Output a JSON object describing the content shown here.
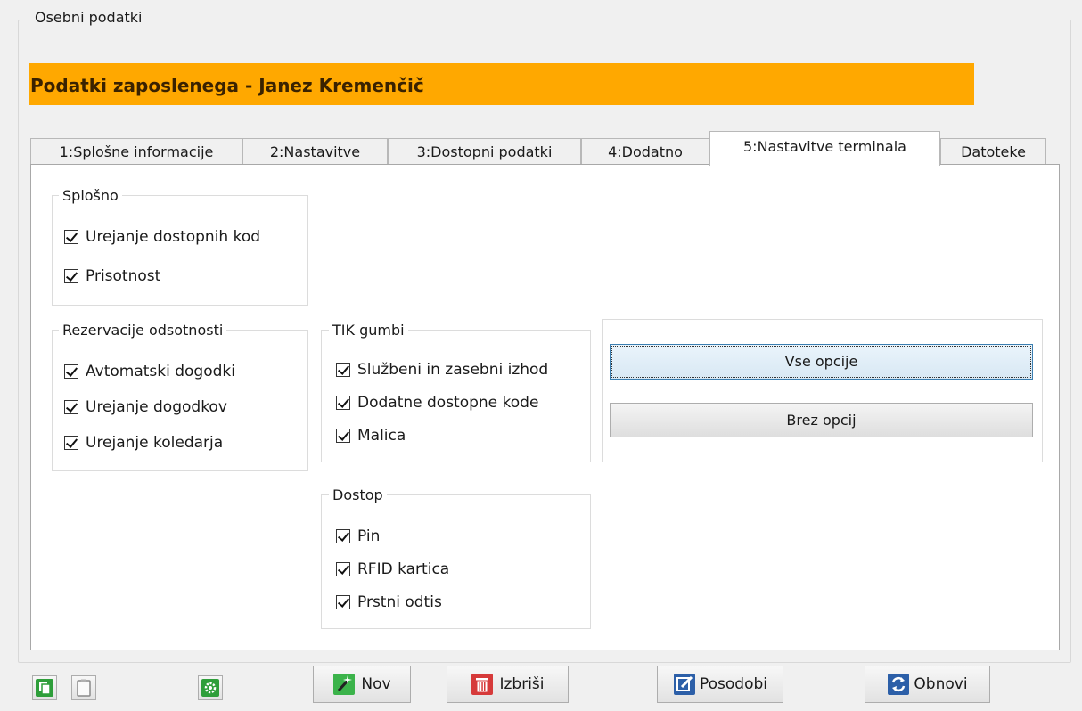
{
  "outer_group": {
    "label": "Osebni podatki"
  },
  "banner": {
    "title": "Podatki zaposlenega - Janez Kremenčič",
    "color": "#ffa800"
  },
  "tabs": [
    {
      "label": "1:Splošne informacije",
      "active": false
    },
    {
      "label": "2:Nastavitve",
      "active": false
    },
    {
      "label": "3:Dostopni podatki",
      "active": false
    },
    {
      "label": "4:Dodatno",
      "active": false
    },
    {
      "label": "5:Nastavitve terminala",
      "active": true
    },
    {
      "label": "Datoteke",
      "active": false
    }
  ],
  "groups": {
    "splosno": {
      "label": "Splošno",
      "items": [
        {
          "label": "Urejanje dostopnih kod",
          "checked": true
        },
        {
          "label": "Prisotnost",
          "checked": true
        }
      ]
    },
    "rezervacije": {
      "label": "Rezervacije odsotnosti",
      "items": [
        {
          "label": "Avtomatski dogodki",
          "checked": true
        },
        {
          "label": "Urejanje dogodkov",
          "checked": true
        },
        {
          "label": "Urejanje koledarja",
          "checked": true
        }
      ]
    },
    "tik": {
      "label": "TIK gumbi",
      "items": [
        {
          "label": "Službeni in zasebni izhod",
          "checked": true
        },
        {
          "label": "Dodatne dostopne kode",
          "checked": true
        },
        {
          "label": "Malica",
          "checked": true
        }
      ]
    },
    "dostop": {
      "label": "Dostop",
      "items": [
        {
          "label": "Pin",
          "checked": true
        },
        {
          "label": "RFID kartica",
          "checked": true
        },
        {
          "label": "Prstni odtis",
          "checked": true
        }
      ]
    }
  },
  "option_buttons": {
    "all": "Vse opcije",
    "none": "Brez opcij"
  },
  "toolbar": {
    "copy_icon": "copy-icon",
    "paste_icon": "clipboard-icon",
    "settings_icon": "gear-icon",
    "new_label": "Nov",
    "delete_label": "Izbriši",
    "update_label": "Posodobi",
    "refresh_label": "Obnovi"
  }
}
